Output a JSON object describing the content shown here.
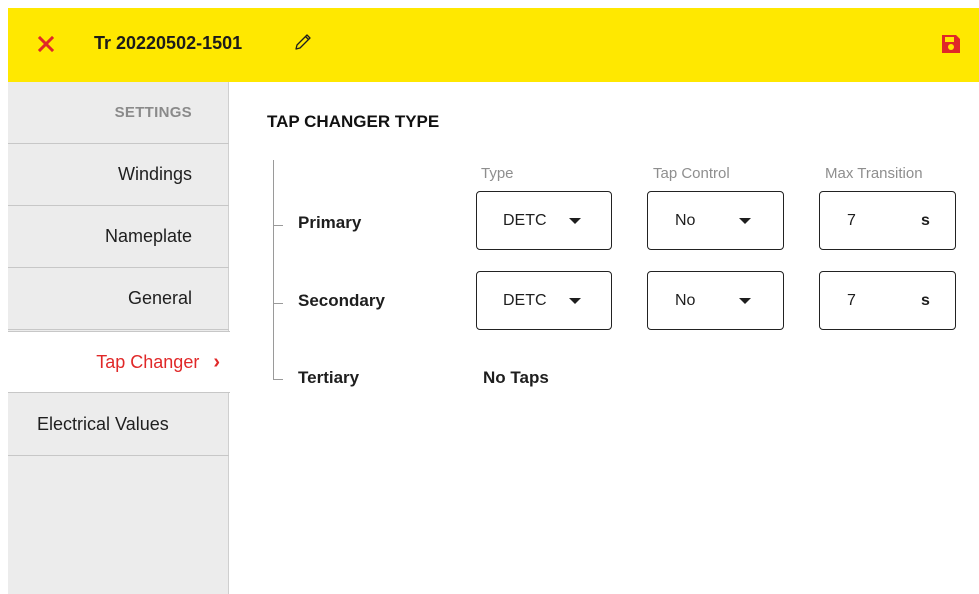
{
  "header": {
    "title": "Tr 20220502-1501",
    "accent_color": "#ffe800",
    "close_color": "#e02828",
    "save_color": "#e02828"
  },
  "sidebar": {
    "header": "SETTINGS",
    "items": [
      {
        "label": "Windings"
      },
      {
        "label": "Nameplate"
      },
      {
        "label": "General"
      },
      {
        "label": "Tap Changer",
        "active": true,
        "chevron": "›"
      },
      {
        "label": "Electrical Values"
      }
    ]
  },
  "main": {
    "section_title": "TAP CHANGER TYPE",
    "columns": {
      "type": "Type",
      "tap_control": "Tap Control",
      "max_transition": "Max Transition"
    },
    "rows": [
      {
        "label": "Primary",
        "type": "DETC",
        "tap_control": "No",
        "max_transition": "7",
        "unit": "s"
      },
      {
        "label": "Secondary",
        "type": "DETC",
        "tap_control": "No",
        "max_transition": "7",
        "unit": "s"
      },
      {
        "label": "Tertiary",
        "note": "No Taps"
      }
    ]
  }
}
